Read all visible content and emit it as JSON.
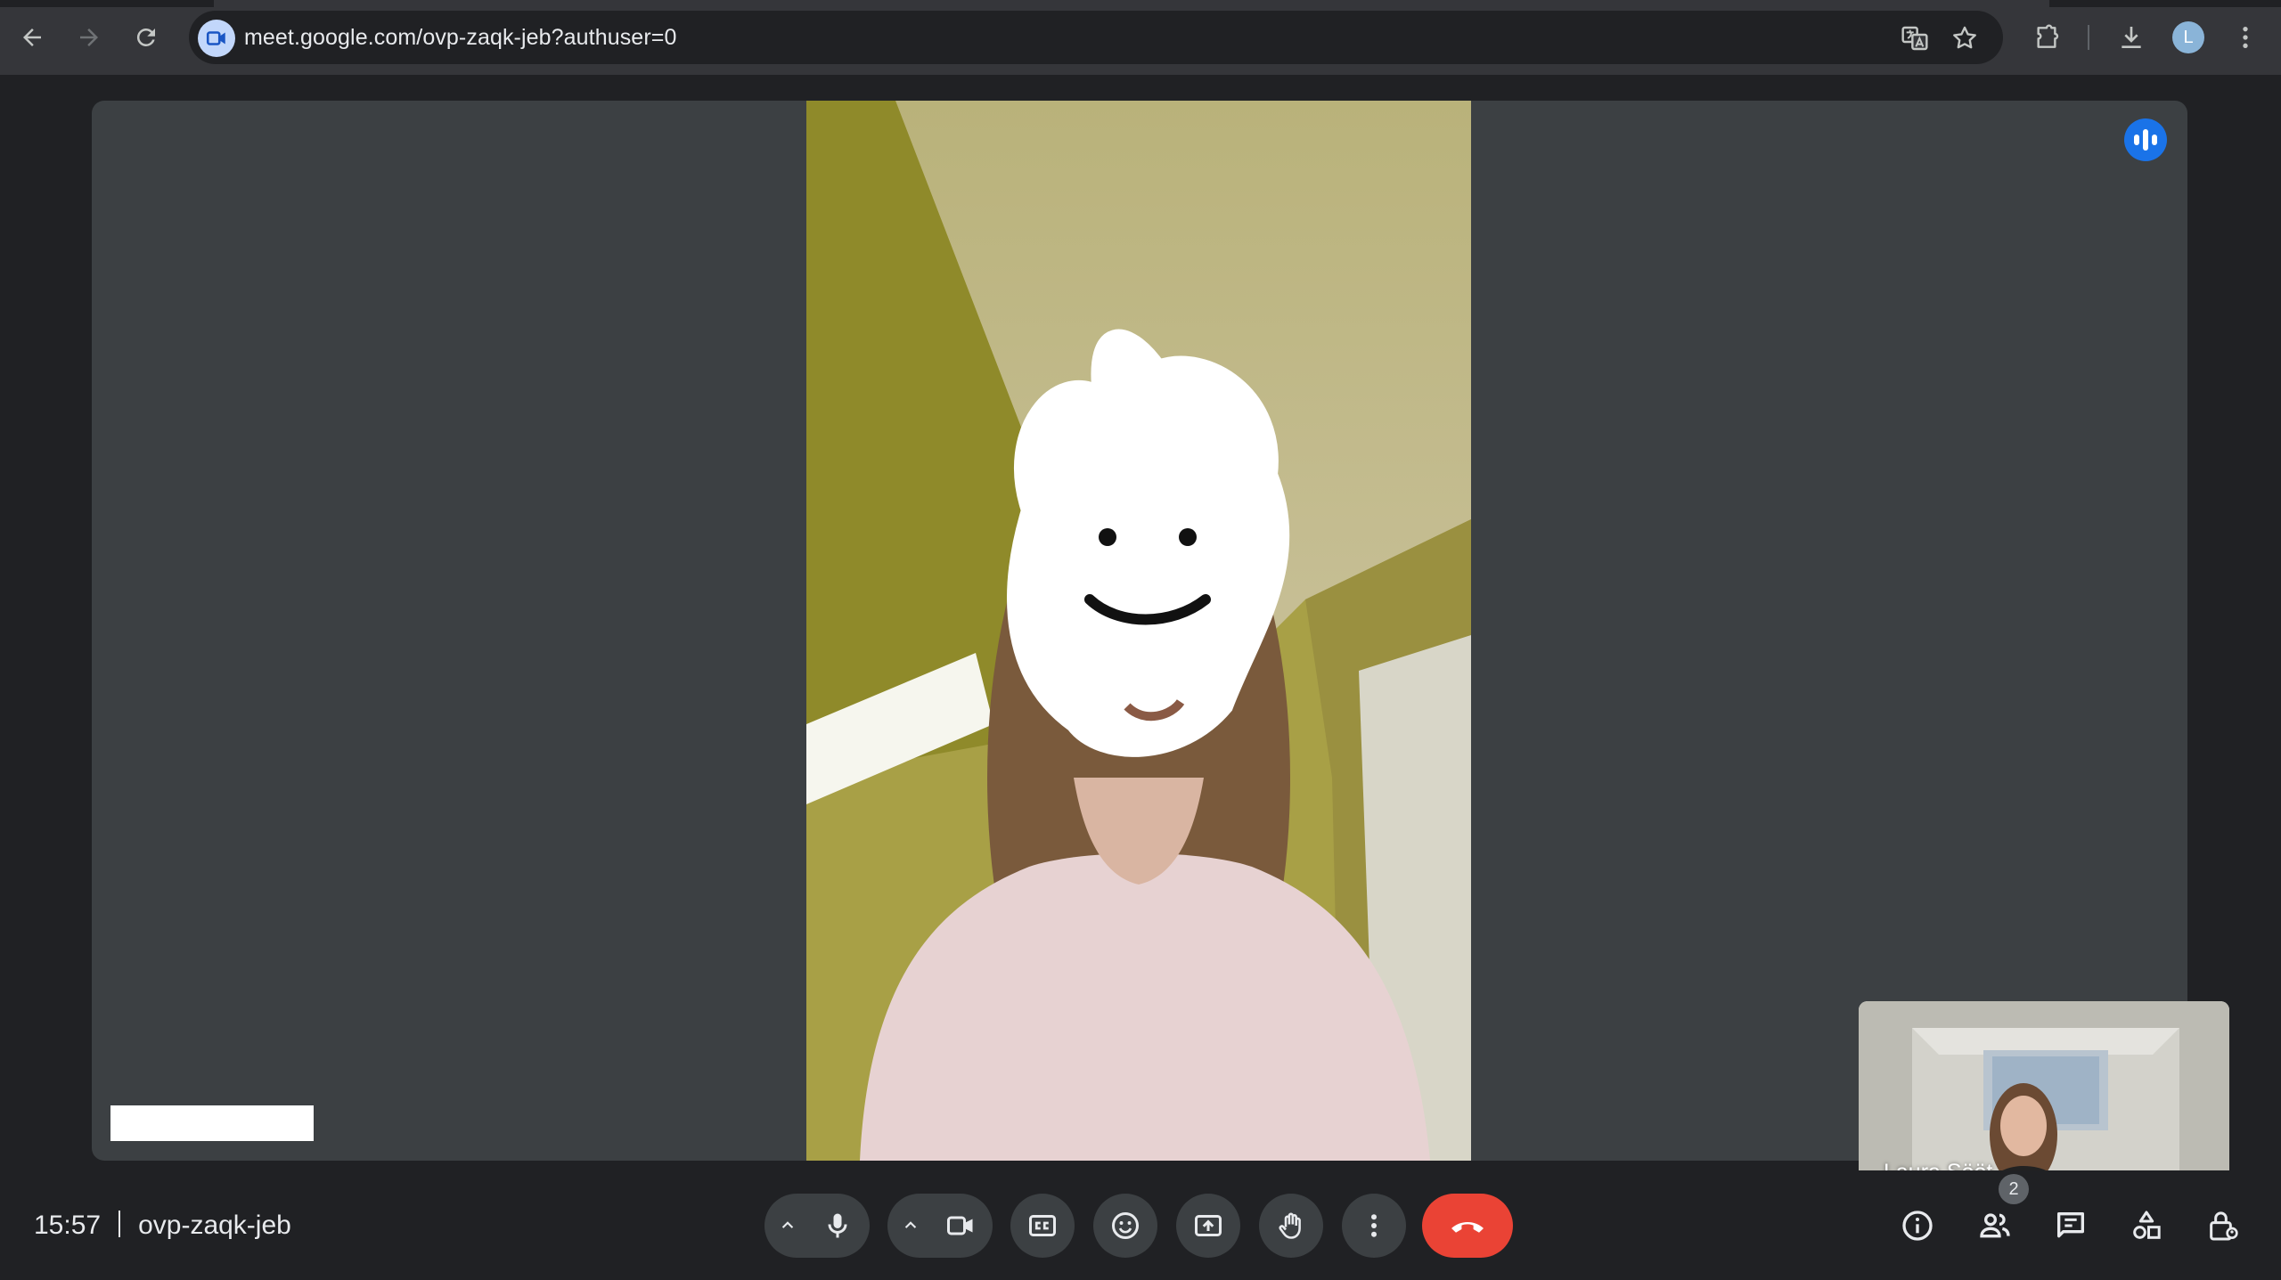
{
  "browser": {
    "url": "meet.google.com/ovp-zaqk-jeb?authuser=0",
    "profile_initial": "L",
    "icons": [
      "back-arrow-icon",
      "forward-arrow-icon",
      "reload-icon",
      "meet-site-icon",
      "translate-icon",
      "star-icon",
      "extensions-icon",
      "download-icon",
      "kebab-menu-icon"
    ]
  },
  "stage": {
    "speaker_name_redacted": "",
    "self_view": {
      "name": "Laura Sööt"
    }
  },
  "controls": {
    "time": "15:57",
    "meeting_code": "ovp-zaqk-jeb",
    "people_count": "2",
    "buttons": [
      "audio-options",
      "microphone",
      "video-options",
      "camera",
      "captions",
      "reactions",
      "present-screen",
      "raise-hand",
      "more-options",
      "leave-call"
    ],
    "side_buttons": [
      "meeting-details",
      "people",
      "chat",
      "activities",
      "host-controls"
    ]
  },
  "colors": {
    "background": "#202124",
    "tile": "#3c4043",
    "button": "#3c4043",
    "end_call": "#ea4335",
    "speaking_indicator": "#1a73e8"
  }
}
